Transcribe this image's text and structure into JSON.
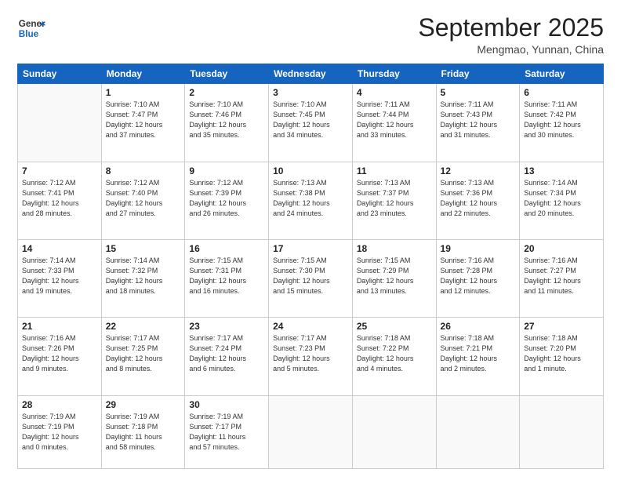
{
  "logo": {
    "line1": "General",
    "line2": "Blue"
  },
  "title": "September 2025",
  "location": "Mengmao, Yunnan, China",
  "days_of_week": [
    "Sunday",
    "Monday",
    "Tuesday",
    "Wednesday",
    "Thursday",
    "Friday",
    "Saturday"
  ],
  "weeks": [
    [
      {
        "day": "",
        "info": ""
      },
      {
        "day": "1",
        "info": "Sunrise: 7:10 AM\nSunset: 7:47 PM\nDaylight: 12 hours\nand 37 minutes."
      },
      {
        "day": "2",
        "info": "Sunrise: 7:10 AM\nSunset: 7:46 PM\nDaylight: 12 hours\nand 35 minutes."
      },
      {
        "day": "3",
        "info": "Sunrise: 7:10 AM\nSunset: 7:45 PM\nDaylight: 12 hours\nand 34 minutes."
      },
      {
        "day": "4",
        "info": "Sunrise: 7:11 AM\nSunset: 7:44 PM\nDaylight: 12 hours\nand 33 minutes."
      },
      {
        "day": "5",
        "info": "Sunrise: 7:11 AM\nSunset: 7:43 PM\nDaylight: 12 hours\nand 31 minutes."
      },
      {
        "day": "6",
        "info": "Sunrise: 7:11 AM\nSunset: 7:42 PM\nDaylight: 12 hours\nand 30 minutes."
      }
    ],
    [
      {
        "day": "7",
        "info": "Sunrise: 7:12 AM\nSunset: 7:41 PM\nDaylight: 12 hours\nand 28 minutes."
      },
      {
        "day": "8",
        "info": "Sunrise: 7:12 AM\nSunset: 7:40 PM\nDaylight: 12 hours\nand 27 minutes."
      },
      {
        "day": "9",
        "info": "Sunrise: 7:12 AM\nSunset: 7:39 PM\nDaylight: 12 hours\nand 26 minutes."
      },
      {
        "day": "10",
        "info": "Sunrise: 7:13 AM\nSunset: 7:38 PM\nDaylight: 12 hours\nand 24 minutes."
      },
      {
        "day": "11",
        "info": "Sunrise: 7:13 AM\nSunset: 7:37 PM\nDaylight: 12 hours\nand 23 minutes."
      },
      {
        "day": "12",
        "info": "Sunrise: 7:13 AM\nSunset: 7:36 PM\nDaylight: 12 hours\nand 22 minutes."
      },
      {
        "day": "13",
        "info": "Sunrise: 7:14 AM\nSunset: 7:34 PM\nDaylight: 12 hours\nand 20 minutes."
      }
    ],
    [
      {
        "day": "14",
        "info": "Sunrise: 7:14 AM\nSunset: 7:33 PM\nDaylight: 12 hours\nand 19 minutes."
      },
      {
        "day": "15",
        "info": "Sunrise: 7:14 AM\nSunset: 7:32 PM\nDaylight: 12 hours\nand 18 minutes."
      },
      {
        "day": "16",
        "info": "Sunrise: 7:15 AM\nSunset: 7:31 PM\nDaylight: 12 hours\nand 16 minutes."
      },
      {
        "day": "17",
        "info": "Sunrise: 7:15 AM\nSunset: 7:30 PM\nDaylight: 12 hours\nand 15 minutes."
      },
      {
        "day": "18",
        "info": "Sunrise: 7:15 AM\nSunset: 7:29 PM\nDaylight: 12 hours\nand 13 minutes."
      },
      {
        "day": "19",
        "info": "Sunrise: 7:16 AM\nSunset: 7:28 PM\nDaylight: 12 hours\nand 12 minutes."
      },
      {
        "day": "20",
        "info": "Sunrise: 7:16 AM\nSunset: 7:27 PM\nDaylight: 12 hours\nand 11 minutes."
      }
    ],
    [
      {
        "day": "21",
        "info": "Sunrise: 7:16 AM\nSunset: 7:26 PM\nDaylight: 12 hours\nand 9 minutes."
      },
      {
        "day": "22",
        "info": "Sunrise: 7:17 AM\nSunset: 7:25 PM\nDaylight: 12 hours\nand 8 minutes."
      },
      {
        "day": "23",
        "info": "Sunrise: 7:17 AM\nSunset: 7:24 PM\nDaylight: 12 hours\nand 6 minutes."
      },
      {
        "day": "24",
        "info": "Sunrise: 7:17 AM\nSunset: 7:23 PM\nDaylight: 12 hours\nand 5 minutes."
      },
      {
        "day": "25",
        "info": "Sunrise: 7:18 AM\nSunset: 7:22 PM\nDaylight: 12 hours\nand 4 minutes."
      },
      {
        "day": "26",
        "info": "Sunrise: 7:18 AM\nSunset: 7:21 PM\nDaylight: 12 hours\nand 2 minutes."
      },
      {
        "day": "27",
        "info": "Sunrise: 7:18 AM\nSunset: 7:20 PM\nDaylight: 12 hours\nand 1 minute."
      }
    ],
    [
      {
        "day": "28",
        "info": "Sunrise: 7:19 AM\nSunset: 7:19 PM\nDaylight: 12 hours\nand 0 minutes."
      },
      {
        "day": "29",
        "info": "Sunrise: 7:19 AM\nSunset: 7:18 PM\nDaylight: 11 hours\nand 58 minutes."
      },
      {
        "day": "30",
        "info": "Sunrise: 7:19 AM\nSunset: 7:17 PM\nDaylight: 11 hours\nand 57 minutes."
      },
      {
        "day": "",
        "info": ""
      },
      {
        "day": "",
        "info": ""
      },
      {
        "day": "",
        "info": ""
      },
      {
        "day": "",
        "info": ""
      }
    ]
  ]
}
